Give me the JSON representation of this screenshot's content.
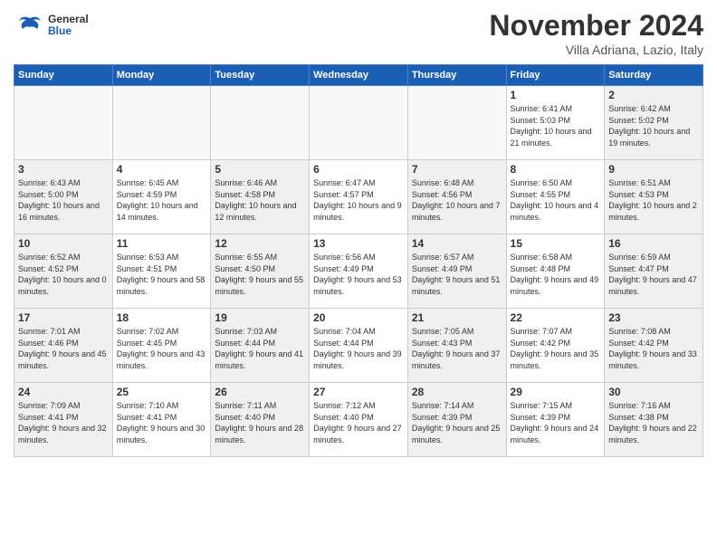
{
  "logo": {
    "text_general": "General",
    "text_blue": "Blue"
  },
  "header": {
    "month": "November 2024",
    "location": "Villa Adriana, Lazio, Italy"
  },
  "weekdays": [
    "Sunday",
    "Monday",
    "Tuesday",
    "Wednesday",
    "Thursday",
    "Friday",
    "Saturday"
  ],
  "weeks": [
    [
      {
        "day": "",
        "info": ""
      },
      {
        "day": "",
        "info": ""
      },
      {
        "day": "",
        "info": ""
      },
      {
        "day": "",
        "info": ""
      },
      {
        "day": "",
        "info": ""
      },
      {
        "day": "1",
        "info": "Sunrise: 6:41 AM\nSunset: 5:03 PM\nDaylight: 10 hours and 21 minutes."
      },
      {
        "day": "2",
        "info": "Sunrise: 6:42 AM\nSunset: 5:02 PM\nDaylight: 10 hours and 19 minutes."
      }
    ],
    [
      {
        "day": "3",
        "info": "Sunrise: 6:43 AM\nSunset: 5:00 PM\nDaylight: 10 hours and 16 minutes."
      },
      {
        "day": "4",
        "info": "Sunrise: 6:45 AM\nSunset: 4:59 PM\nDaylight: 10 hours and 14 minutes."
      },
      {
        "day": "5",
        "info": "Sunrise: 6:46 AM\nSunset: 4:58 PM\nDaylight: 10 hours and 12 minutes."
      },
      {
        "day": "6",
        "info": "Sunrise: 6:47 AM\nSunset: 4:57 PM\nDaylight: 10 hours and 9 minutes."
      },
      {
        "day": "7",
        "info": "Sunrise: 6:48 AM\nSunset: 4:56 PM\nDaylight: 10 hours and 7 minutes."
      },
      {
        "day": "8",
        "info": "Sunrise: 6:50 AM\nSunset: 4:55 PM\nDaylight: 10 hours and 4 minutes."
      },
      {
        "day": "9",
        "info": "Sunrise: 6:51 AM\nSunset: 4:53 PM\nDaylight: 10 hours and 2 minutes."
      }
    ],
    [
      {
        "day": "10",
        "info": "Sunrise: 6:52 AM\nSunset: 4:52 PM\nDaylight: 10 hours and 0 minutes."
      },
      {
        "day": "11",
        "info": "Sunrise: 6:53 AM\nSunset: 4:51 PM\nDaylight: 9 hours and 58 minutes."
      },
      {
        "day": "12",
        "info": "Sunrise: 6:55 AM\nSunset: 4:50 PM\nDaylight: 9 hours and 55 minutes."
      },
      {
        "day": "13",
        "info": "Sunrise: 6:56 AM\nSunset: 4:49 PM\nDaylight: 9 hours and 53 minutes."
      },
      {
        "day": "14",
        "info": "Sunrise: 6:57 AM\nSunset: 4:49 PM\nDaylight: 9 hours and 51 minutes."
      },
      {
        "day": "15",
        "info": "Sunrise: 6:58 AM\nSunset: 4:48 PM\nDaylight: 9 hours and 49 minutes."
      },
      {
        "day": "16",
        "info": "Sunrise: 6:59 AM\nSunset: 4:47 PM\nDaylight: 9 hours and 47 minutes."
      }
    ],
    [
      {
        "day": "17",
        "info": "Sunrise: 7:01 AM\nSunset: 4:46 PM\nDaylight: 9 hours and 45 minutes."
      },
      {
        "day": "18",
        "info": "Sunrise: 7:02 AM\nSunset: 4:45 PM\nDaylight: 9 hours and 43 minutes."
      },
      {
        "day": "19",
        "info": "Sunrise: 7:03 AM\nSunset: 4:44 PM\nDaylight: 9 hours and 41 minutes."
      },
      {
        "day": "20",
        "info": "Sunrise: 7:04 AM\nSunset: 4:44 PM\nDaylight: 9 hours and 39 minutes."
      },
      {
        "day": "21",
        "info": "Sunrise: 7:05 AM\nSunset: 4:43 PM\nDaylight: 9 hours and 37 minutes."
      },
      {
        "day": "22",
        "info": "Sunrise: 7:07 AM\nSunset: 4:42 PM\nDaylight: 9 hours and 35 minutes."
      },
      {
        "day": "23",
        "info": "Sunrise: 7:08 AM\nSunset: 4:42 PM\nDaylight: 9 hours and 33 minutes."
      }
    ],
    [
      {
        "day": "24",
        "info": "Sunrise: 7:09 AM\nSunset: 4:41 PM\nDaylight: 9 hours and 32 minutes."
      },
      {
        "day": "25",
        "info": "Sunrise: 7:10 AM\nSunset: 4:41 PM\nDaylight: 9 hours and 30 minutes."
      },
      {
        "day": "26",
        "info": "Sunrise: 7:11 AM\nSunset: 4:40 PM\nDaylight: 9 hours and 28 minutes."
      },
      {
        "day": "27",
        "info": "Sunrise: 7:12 AM\nSunset: 4:40 PM\nDaylight: 9 hours and 27 minutes."
      },
      {
        "day": "28",
        "info": "Sunrise: 7:14 AM\nSunset: 4:39 PM\nDaylight: 9 hours and 25 minutes."
      },
      {
        "day": "29",
        "info": "Sunrise: 7:15 AM\nSunset: 4:39 PM\nDaylight: 9 hours and 24 minutes."
      },
      {
        "day": "30",
        "info": "Sunrise: 7:16 AM\nSunset: 4:38 PM\nDaylight: 9 hours and 22 minutes."
      }
    ]
  ]
}
